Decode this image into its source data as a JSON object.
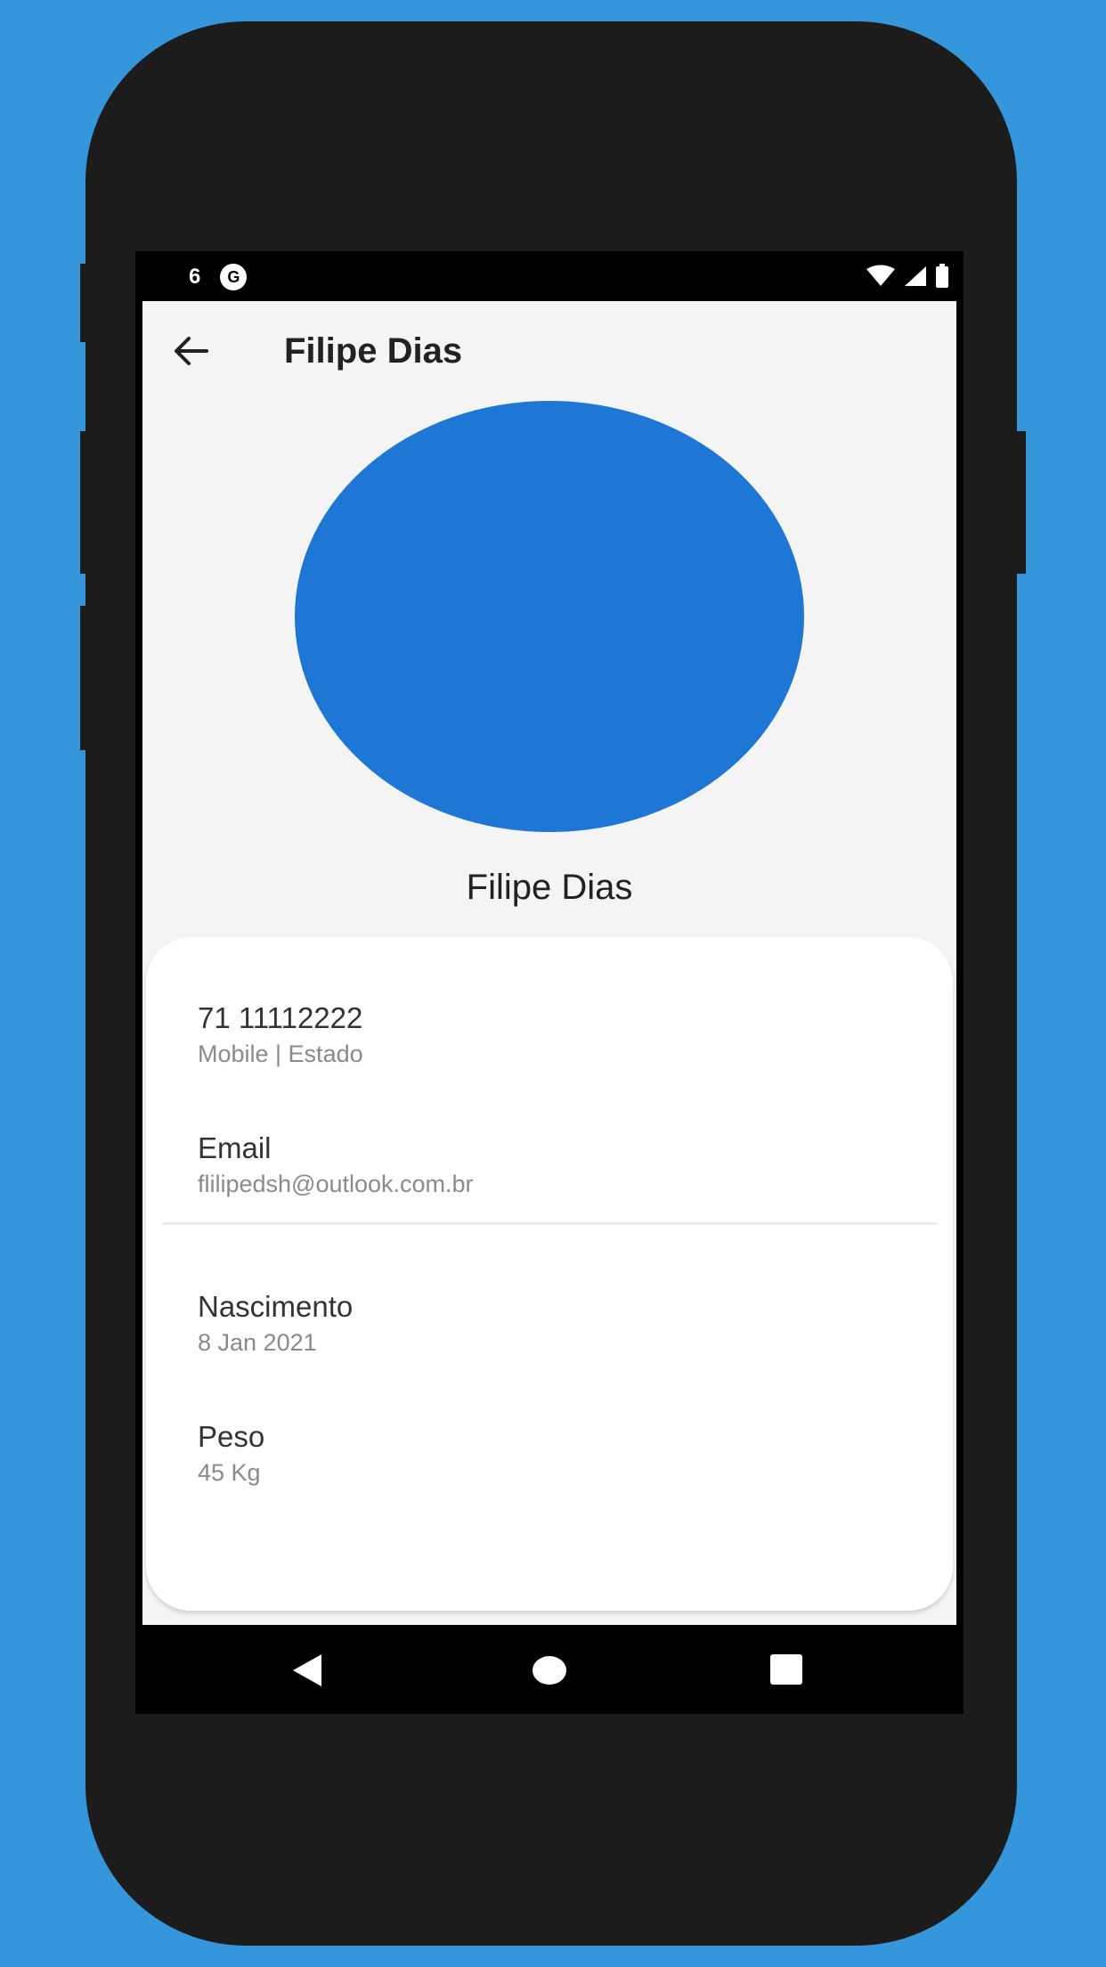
{
  "status_bar": {
    "time": "6",
    "notification_icon": "G"
  },
  "app_bar": {
    "title": "Filipe Dias"
  },
  "profile": {
    "name": "Filipe Dias",
    "avatar_color": "#1E76D5"
  },
  "details": [
    {
      "title": "71 11112222",
      "subtitle": "Mobile | Estado"
    },
    {
      "title": "Email",
      "subtitle": "flilipedsh@outlook.com.br"
    },
    {
      "title": "Nascimento",
      "subtitle": "8 Jan 2021"
    },
    {
      "title": "Peso",
      "subtitle": "45 Kg"
    }
  ],
  "colors": {
    "background": "#3596DB",
    "accent": "#1E76D5",
    "phone_frame": "#1C1C1C"
  },
  "icons": {
    "back": "arrow-left-icon",
    "wifi": "wifi-icon",
    "signal": "signal-icon",
    "battery": "battery-icon",
    "nav_back": "triangle-back-icon",
    "nav_home": "circle-home-icon",
    "nav_recent": "square-recent-icon"
  }
}
